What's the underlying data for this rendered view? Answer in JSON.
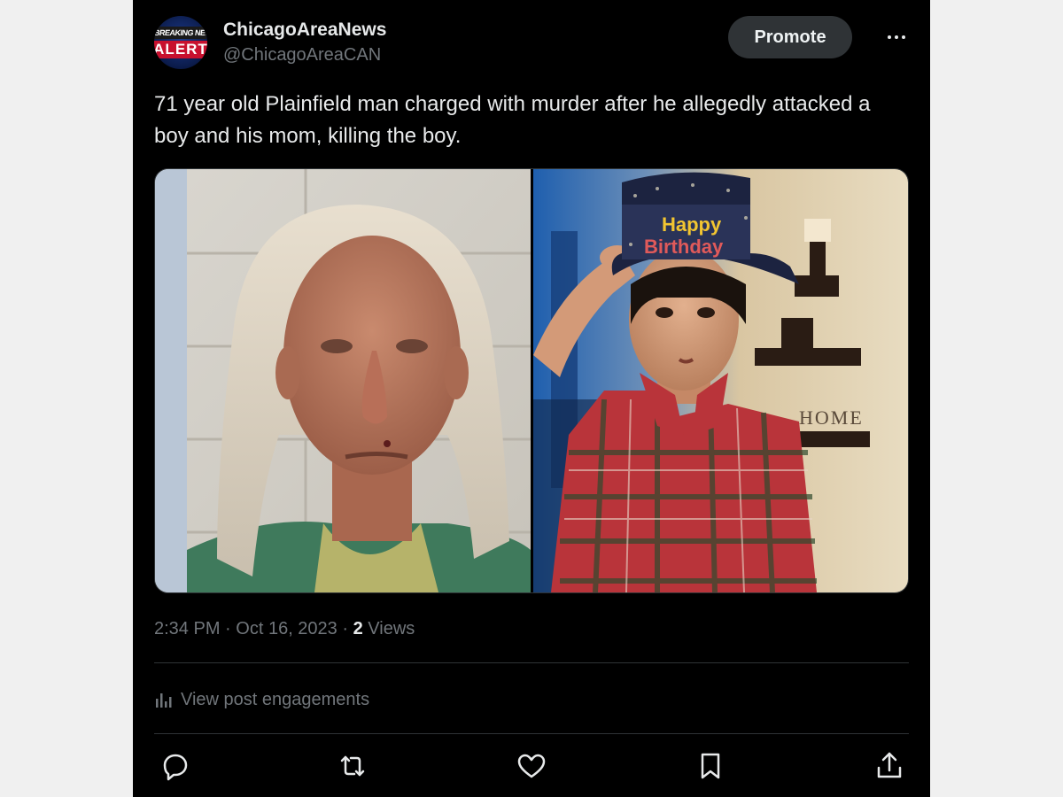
{
  "post": {
    "author": {
      "display_name": "ChicagoAreaNews",
      "handle": "@ChicagoAreaCAN",
      "avatar_text_top": "BREAKING NEWS",
      "avatar_text_bottom": "ALERT"
    },
    "promote_label": "Promote",
    "more_icon": "more-horizontal-icon",
    "text": "71 year old Plainfield man charged with murder after he allegedly attacked a boy and his mom, killing the boy.",
    "media": [
      {
        "kind": "photo",
        "subject": "mugshot"
      },
      {
        "kind": "photo",
        "subject": "boy",
        "hat_text": [
          "Happy",
          "Birthday"
        ],
        "sign_text": "HOME"
      }
    ],
    "meta": {
      "time": "2:34 PM",
      "date": "Oct 16, 2023",
      "separator": "·",
      "views_count": "2",
      "views_label": "Views"
    },
    "engagements": {
      "icon": "analytics-icon",
      "label": "View post engagements"
    },
    "actions": [
      {
        "name": "reply",
        "icon": "reply-icon"
      },
      {
        "name": "repost",
        "icon": "repost-icon"
      },
      {
        "name": "like",
        "icon": "heart-icon"
      },
      {
        "name": "bookmark",
        "icon": "bookmark-icon"
      },
      {
        "name": "share",
        "icon": "share-icon"
      }
    ]
  },
  "colors": {
    "background": "#000000",
    "page_background": "#f0f0f0",
    "text_primary": "#e7e9ea",
    "text_secondary": "#71767b",
    "divider": "#2f3336",
    "button_bg": "#2f3336"
  }
}
